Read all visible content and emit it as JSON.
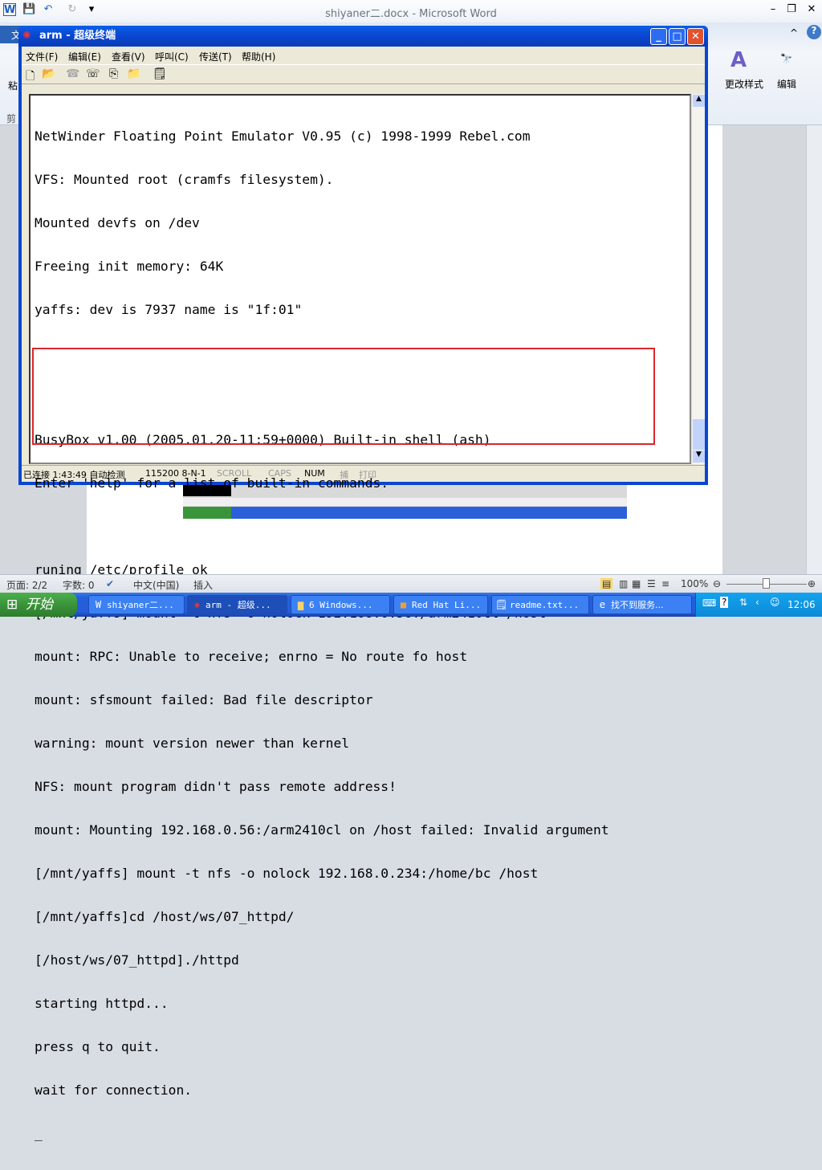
{
  "word": {
    "title": "shiyaner二.docx - Microsoft Word",
    "ribbon_style_label": "更改样式",
    "ribbon_edit_label": "编辑",
    "tab_partial": "文",
    "left_partial": "粘",
    "left_partial2": "剪",
    "status": {
      "page": "页面: 2/2",
      "words": "字数: 0",
      "language": "中文(中国)",
      "mode": "插入",
      "zoom": "100%"
    }
  },
  "terminal": {
    "title": "arm - 超级终端",
    "menu": [
      "文件(F)",
      "编辑(E)",
      "查看(V)",
      "呼叫(C)",
      "传送(T)",
      "帮助(H)"
    ],
    "lines": [
      "NetWinder Floating Point Emulator V0.95 (c) 1998-1999 Rebel.com",
      "VFS: Mounted root (cramfs filesystem).",
      "Mounted devfs on /dev",
      "Freeing init memory: 64K",
      "yaffs: dev is 7937 name is \"1f:01\"",
      "",
      "",
      "BusyBox v1.00 (2005.01.20-11:59+0000) Built-in shell (ash)",
      "Enter 'help' for a list of built-in commands.",
      "",
      "runing /etc/profile ok",
      "[/mnt/yaffs] mount -t nfs -o nolock 192.168.0.56:/arm2410cl /host",
      "mount: RPC: Unable to receive; enrno = No route fo host",
      "mount: sfsmount failed: Bad file descriptor",
      "warning: mount version newer than kernel",
      "NFS: mount program didn't pass remote address!",
      "mount: Mounting 192.168.0.56:/arm2410cl on /host failed: Invalid argument",
      "[/mnt/yaffs] mount -t nfs -o nolock 192.168.0.234:/home/bc /host",
      "[/mnt/yaffs]cd /host/ws/07_httpd/",
      "[/host/ws/07_httpd]./httpd",
      "starting httpd...",
      "press q to quit.",
      "wait for connection.",
      "_"
    ],
    "status": {
      "connected": "已连接 1:43:49 自动检测",
      "port": "115200 8-N-1",
      "scroll": "SCROLL",
      "caps": "CAPS",
      "num": "NUM",
      "capture": "捕",
      "print": "打印"
    }
  },
  "taskbar": {
    "start": "开始",
    "items": [
      "shiyaner二...",
      "arm - 超级...",
      "6 Windows...",
      "Red Hat Li...",
      "readme.txt...",
      "找不到服务..."
    ],
    "clock": "12:06"
  },
  "colors": {
    "highlight_box": "#d9262c",
    "taskbar": "#245edb"
  }
}
